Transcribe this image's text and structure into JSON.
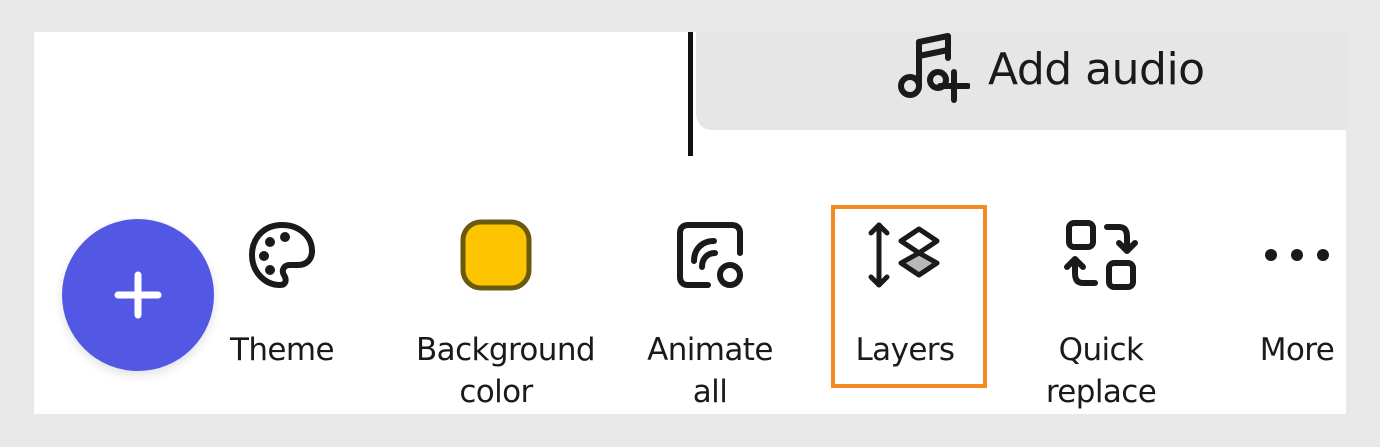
{
  "audio": {
    "label": "Add audio",
    "icon": "music-note-plus-icon"
  },
  "fab": {
    "icon": "plus-icon",
    "color": "#5258e4"
  },
  "toolbar": {
    "items": [
      {
        "id": "theme",
        "label": "Theme",
        "icon": "palette-icon"
      },
      {
        "id": "background-color",
        "label": "Background color",
        "icon": "color-swatch-icon",
        "swatch_color": "#ffc400"
      },
      {
        "id": "animate-all",
        "label": "Animate all",
        "icon": "animate-icon"
      },
      {
        "id": "layers",
        "label": "Layers",
        "icon": "layers-icon",
        "highlighted": true
      },
      {
        "id": "quick-replace",
        "label": "Quick replace",
        "icon": "swap-icon"
      },
      {
        "id": "more",
        "label": "More",
        "icon": "more-dots-icon"
      }
    ],
    "highlight_color": "#f28a1f"
  }
}
